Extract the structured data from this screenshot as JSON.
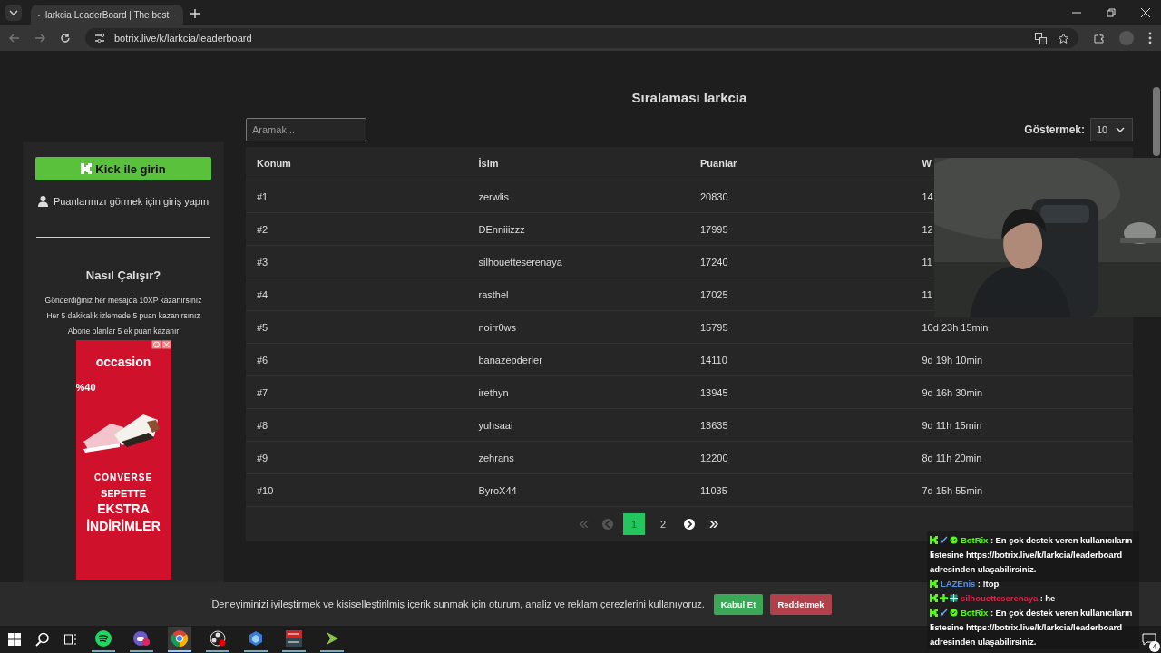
{
  "browser": {
    "tab_title": "larkcia LeaderBoard | The best",
    "url": "botrix.live/k/larkcia/leaderboard"
  },
  "sidebar": {
    "login_button": "Kick ile girin",
    "login_hint": "Puanlarınızı görmek için giriş yapın",
    "how_title": "Nasıl Çalışır?",
    "how_lines": [
      "Gönderdiğiniz her mesajda 10XP kazanırsınız",
      "Her 5 dakikalık izlemede 5 puan kazanırsınız",
      "Abone olanlar 5 ek puan kazanır"
    ],
    "ad": {
      "brand": "occasion",
      "discount": "%40",
      "maker": "CONVERSE",
      "lines": [
        "SEPETTE",
        "EKSTRA",
        "İNDİRİMLER"
      ]
    }
  },
  "title": "Sıralaması larkcia",
  "search": {
    "placeholder": "Aramak..."
  },
  "show": {
    "label": "Göstermek:",
    "value": "10"
  },
  "table": {
    "columns": [
      "Konum",
      "İsim",
      "Puanlar",
      "W"
    ],
    "rows": [
      {
        "cells": [
          "#1",
          "zerwlis",
          "20830",
          "14"
        ]
      },
      {
        "cells": [
          "#2",
          "DEnniiizzz",
          "17995",
          "12"
        ]
      },
      {
        "cells": [
          "#3",
          "silhouetteserenaya",
          "17240",
          "11"
        ]
      },
      {
        "cells": [
          "#4",
          "rasthel",
          "17025",
          "11"
        ]
      },
      {
        "cells": [
          "#5",
          "noirr0ws",
          "15795",
          "10d 23h 15min"
        ]
      },
      {
        "cells": [
          "#6",
          "banazepderler",
          "14110",
          "9d 19h 10min"
        ]
      },
      {
        "cells": [
          "#7",
          "irethyn",
          "13945",
          "9d 16h 30min"
        ]
      },
      {
        "cells": [
          "#8",
          "yuhsaai",
          "13635",
          "9d 11h 15min"
        ]
      },
      {
        "cells": [
          "#9",
          "zehrans",
          "12200",
          "8d 11h 20min"
        ]
      },
      {
        "cells": [
          "#10",
          "ByroX44",
          "11035",
          "7d 15h 55min"
        ]
      }
    ]
  },
  "pagination": {
    "first_disabled": true,
    "prev_disabled": true,
    "next_disabled": false,
    "last_disabled": false,
    "pages": [
      {
        "label": "1",
        "selected": true
      },
      {
        "label": "2",
        "selected": false
      }
    ]
  },
  "cookie_bar": {
    "text": "Deneyiminizi iyileştirmek ve kişiselleştirilmiş içerik sunmak için oturum, analiz ve reklam çerezlerini kullanıyoruz.",
    "accept": "Kabul Et",
    "reject": "Reddetmek"
  },
  "chat": [
    {
      "kind": "bot",
      "user": "BotRix",
      "color": "#53fc18",
      "text": ": En çok destek veren kullanıcıların listesine https://botrix.live/k/larkcia/leaderboard adresinden ulaşabilirsiniz."
    },
    {
      "kind": "viewer",
      "user": "LAZEnis",
      "color": "#5b8fd6",
      "text": ": !top"
    },
    {
      "kind": "subscriber",
      "user": "silhouetteserenaya",
      "color": "#d0284e",
      "text": ": he"
    },
    {
      "kind": "bot",
      "user": "BotRix",
      "color": "#53fc18",
      "text": ": En çok destek veren kullanıcıların listesine https://botrix.live/k/larkcia/leaderboard adresinden ulaşabilirsiniz."
    }
  ],
  "taskbar": {
    "apps": [
      {
        "kind": "spotify",
        "active": false
      },
      {
        "kind": "discord",
        "active": false
      },
      {
        "kind": "chrome",
        "active": true
      },
      {
        "kind": "obs",
        "active": false
      },
      {
        "kind": "cube",
        "active": false
      },
      {
        "kind": "voicemeeter",
        "active": false
      },
      {
        "kind": "arrow",
        "active": false
      }
    ],
    "notifications": "4"
  }
}
